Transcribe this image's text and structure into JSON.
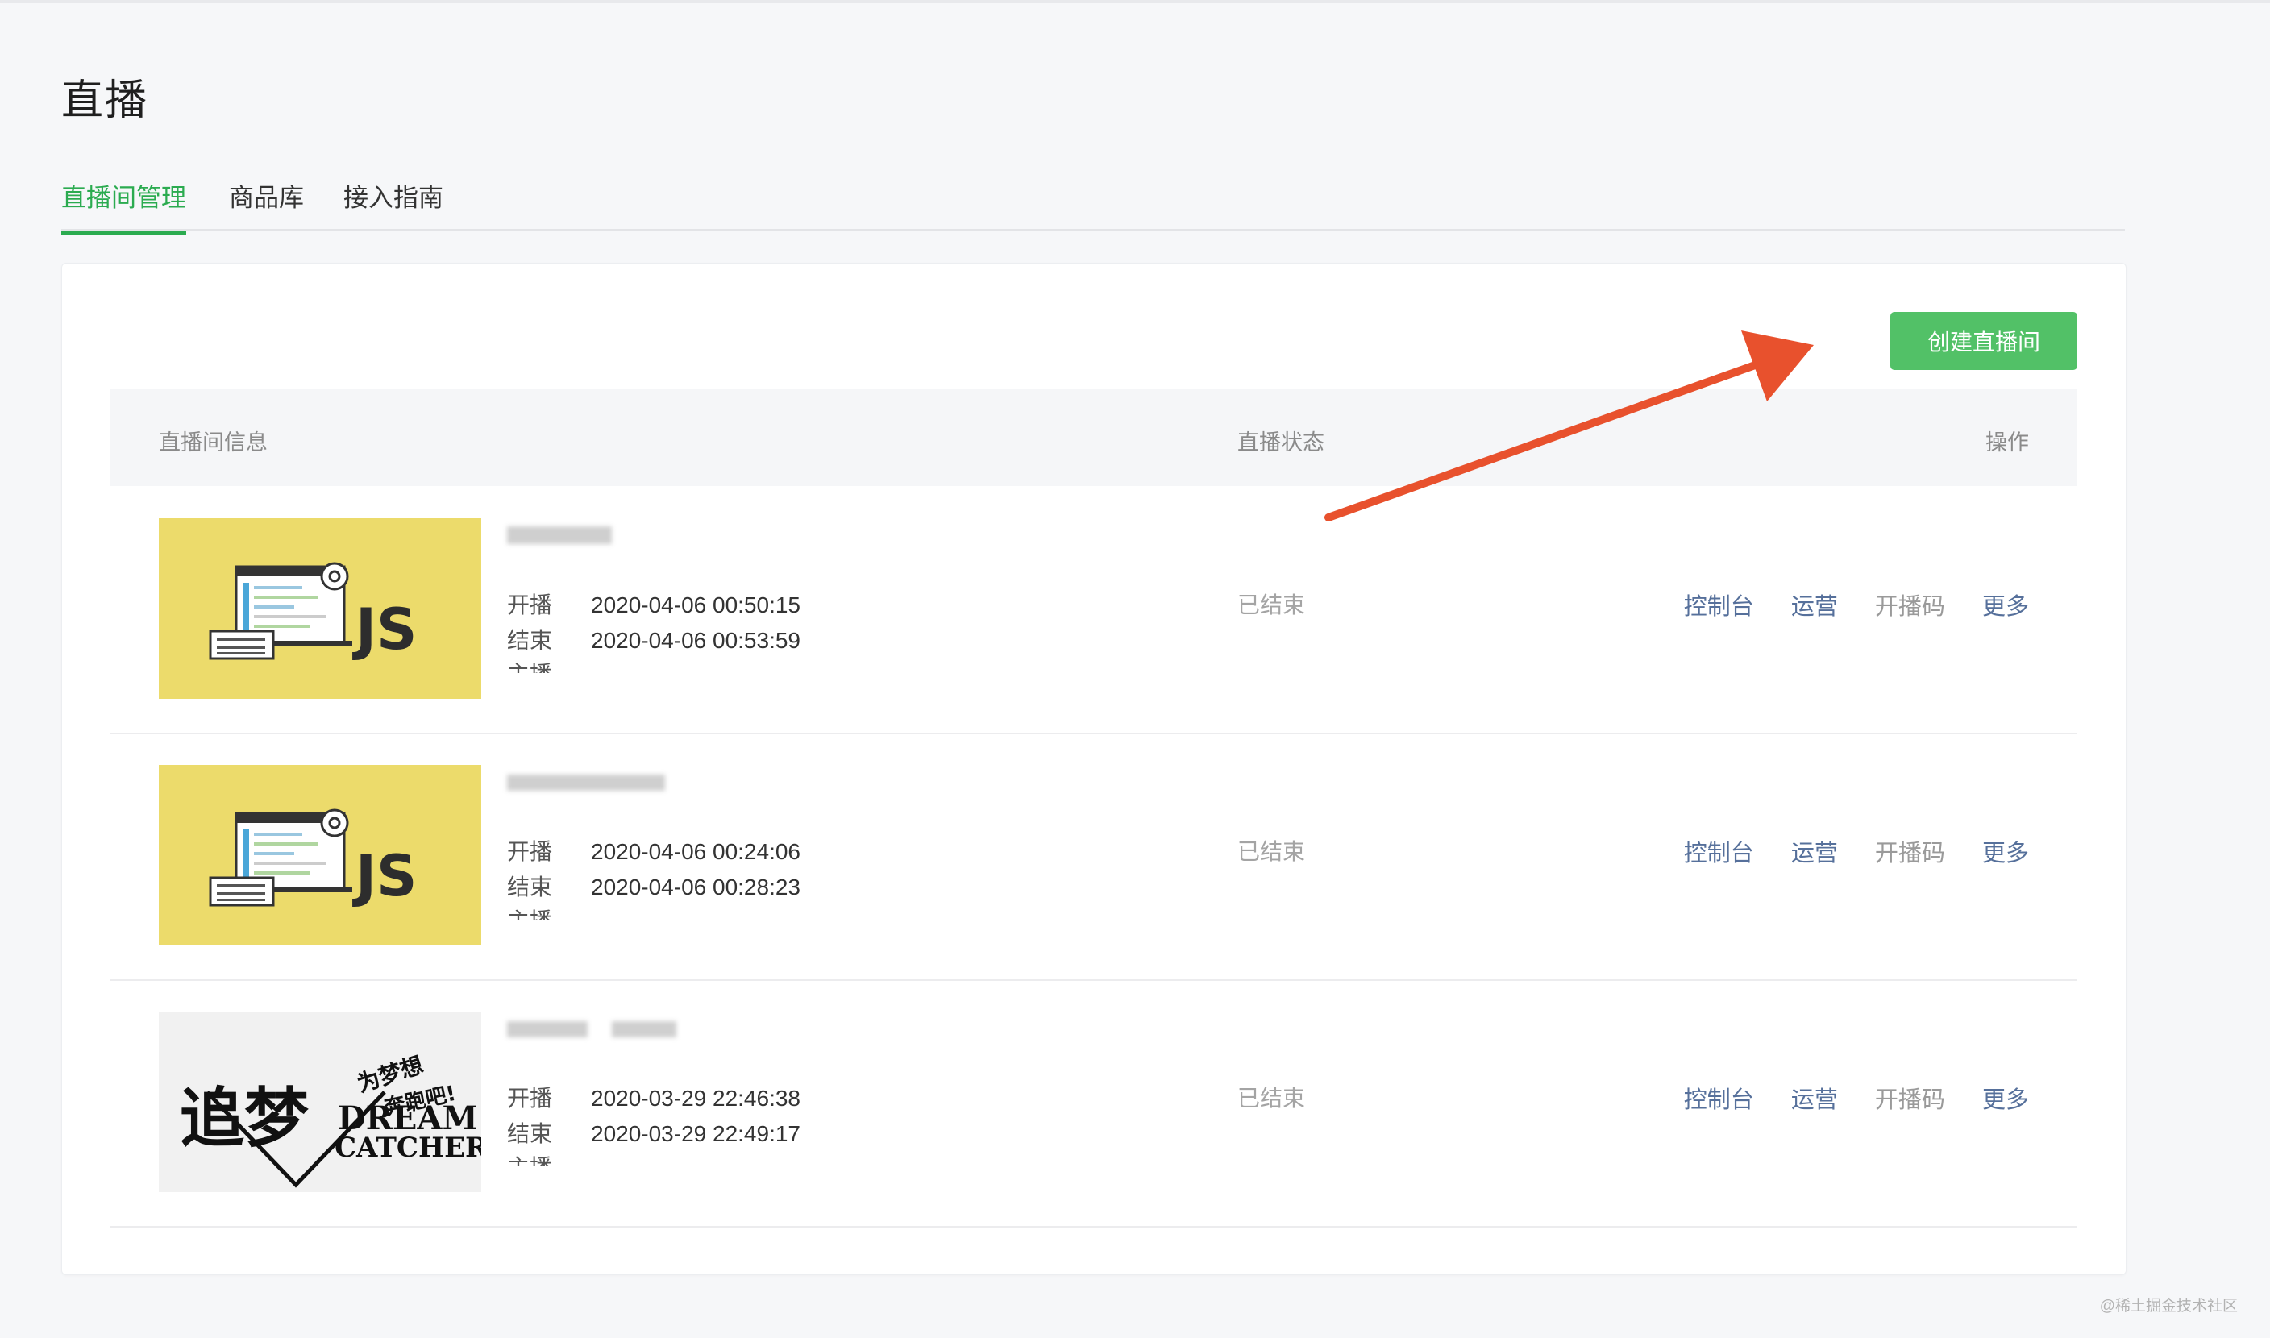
{
  "page": {
    "title": "直播"
  },
  "tabs": [
    {
      "label": "直播间管理",
      "active": true
    },
    {
      "label": "商品库",
      "active": false
    },
    {
      "label": "接入指南",
      "active": false
    }
  ],
  "toolbar": {
    "create_label": "创建直播间"
  },
  "table": {
    "headers": [
      "直播间信息",
      "直播状态",
      "操作"
    ],
    "rows": [
      {
        "thumbnail": "js-thumbnail",
        "title": "",
        "start_label": "开播",
        "start_time": "2020-04-06 00:50:15",
        "end_label": "结束",
        "end_time": "2020-04-06 00:53:59",
        "host_label": "主播",
        "status": "已结束",
        "actions": [
          "控制台",
          "运营",
          "开播码",
          "更多"
        ]
      },
      {
        "thumbnail": "js-thumbnail",
        "title": "",
        "start_label": "开播",
        "start_time": "2020-04-06 00:24:06",
        "end_label": "结束",
        "end_time": "2020-04-06 00:28:23",
        "host_label": "主播",
        "status": "已结束",
        "actions": [
          "控制台",
          "运营",
          "开播码",
          "更多"
        ]
      },
      {
        "thumbnail": "dream-catcher-thumbnail",
        "title": "",
        "start_label": "开播",
        "start_time": "2020-03-29 22:46:38",
        "end_label": "结束",
        "end_time": "2020-03-29 22:49:17",
        "host_label": "主播",
        "status": "已结束",
        "actions": [
          "控制台",
          "运营",
          "开播码",
          "更多"
        ]
      }
    ]
  },
  "watermark": "@稀土掘金技术社区",
  "colors": {
    "accent": "#2bab50",
    "button": "#52c167",
    "link": "#56709b",
    "arrow": "#e8512d"
  }
}
